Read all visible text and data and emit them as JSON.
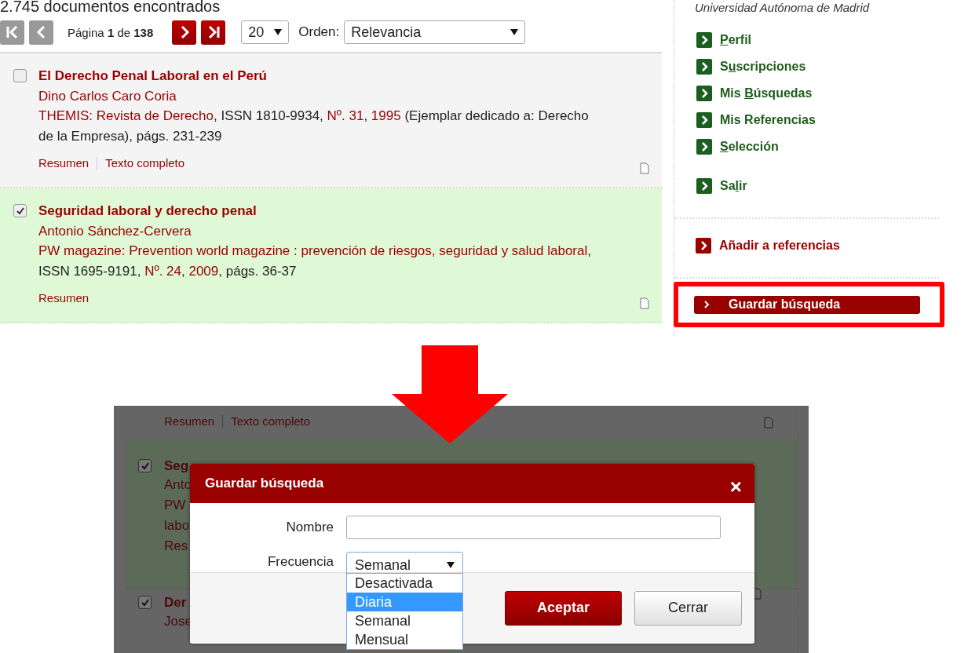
{
  "results": {
    "count_text": "2.745 documentos encontrados",
    "pager": {
      "buttons": [
        {
          "kind": "first",
          "disabled": true
        },
        {
          "kind": "prev",
          "disabled": true
        },
        {
          "kind": "next",
          "disabled": false
        },
        {
          "kind": "last",
          "disabled": false
        }
      ],
      "page_text": "Página **1** de **138**",
      "per_page": "20",
      "order_label": "Orden:",
      "order_value": "Relevancia"
    },
    "items": [
      {
        "checked": false,
        "title": "El Derecho Penal Laboral en el Perú",
        "author": "Dino Carlos Caro Coria",
        "source": [
          {
            "text": "THEMIS: Revista de Derecho",
            "link": true
          },
          {
            "text": ", ISSN 1810-9934, ",
            "link": false
          },
          {
            "text": "Nº. 31",
            "link": true
          },
          {
            "text": ", ",
            "link": false
          },
          {
            "text": "1995",
            "link": true
          },
          {
            "text": " (Ejemplar dedicado a: Derecho de la Empresa), págs. 231-239",
            "link": false
          }
        ],
        "actions": [
          "Resumen",
          "Texto completo"
        ]
      },
      {
        "checked": true,
        "title": "Seguridad laboral y derecho penal",
        "author": "Antonio Sánchez-Cervera",
        "source": [
          {
            "text": "PW magazine: Prevention world magazine : prevención de riesgos, seguridad y salud laboral",
            "link": true
          },
          {
            "text": ", ISSN 1695-9191, ",
            "link": false
          },
          {
            "text": "Nº. 24",
            "link": true
          },
          {
            "text": ", ",
            "link": false
          },
          {
            "text": "2009",
            "link": true
          },
          {
            "text": ", págs. 36-37",
            "link": false
          }
        ],
        "actions": [
          "Resumen"
        ]
      }
    ]
  },
  "sidebar": {
    "university": "Universidad Autónoma de Madrid",
    "menu": [
      {
        "key": "P",
        "after": "erfil"
      },
      {
        "before": "S",
        "key": "u",
        "after": "scripciones"
      },
      {
        "before": "Mis ",
        "key": "B",
        "after": "úsquedas"
      },
      {
        "before": "Mis Referencias"
      },
      {
        "key": "S",
        "after": "elección"
      },
      {
        "before": "Sa",
        "key": "l",
        "after": "ir"
      }
    ],
    "add_reference": "Añadir a referencias",
    "save_search": {
      "label": "Guardar búsqueda",
      "highlighted": true
    }
  },
  "dialog_screenshot": {
    "background": {
      "actions": [
        "Resumen",
        "Texto completo"
      ],
      "fragments": [
        "Seg",
        "Anto",
        "PW",
        "labo",
        "Res"
      ],
      "next_row_fragments": [
        "Der",
        "Jose"
      ],
      "checks": [
        true,
        true
      ]
    },
    "dialog": {
      "title": "Guardar búsqueda",
      "close": "×",
      "name_label": "Nombre",
      "frequency_label": "Frecuencia",
      "frequency_value": "Semanal",
      "options": [
        {
          "label": "Desactivada",
          "selected": false
        },
        {
          "label": "Diaria",
          "selected": true
        },
        {
          "label": "Semanal",
          "selected": false
        },
        {
          "label": "Mensual",
          "selected": false
        }
      ],
      "buttons": [
        {
          "label": "Aceptar",
          "kind": "primary"
        },
        {
          "label": "Cerrar",
          "kind": "secondary"
        }
      ]
    }
  }
}
